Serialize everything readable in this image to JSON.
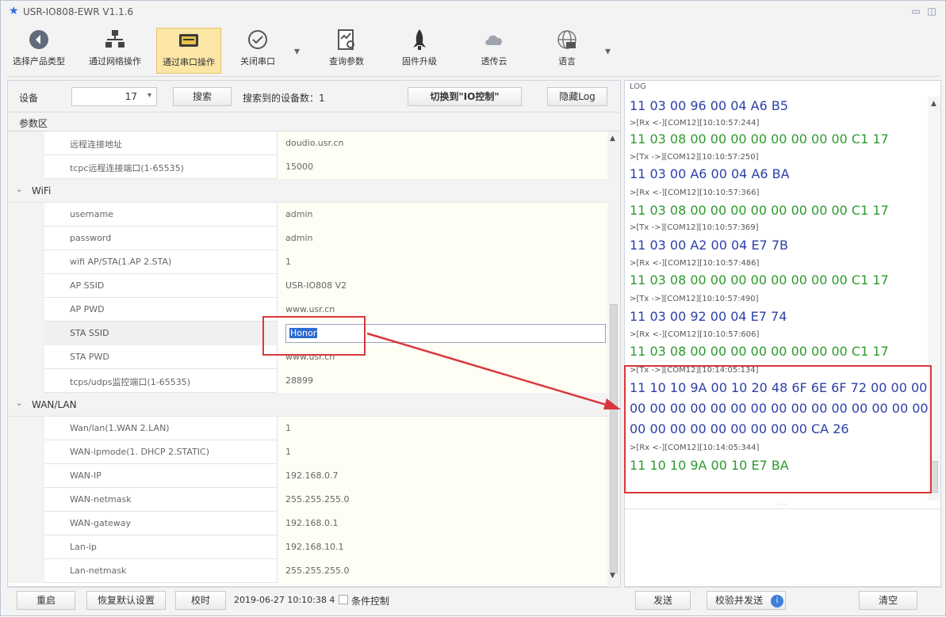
{
  "window": {
    "title": "USR-IO808-EWR V1.1.6",
    "minimize": "▭",
    "maximize": "◫"
  },
  "toolbar": {
    "items": [
      {
        "label": "选择产品类型",
        "icon": "back-arrow-icon"
      },
      {
        "label": "通过网络操作",
        "icon": "network-icon"
      },
      {
        "label": "通过串口操作",
        "icon": "serial-port-icon",
        "active": true
      },
      {
        "label": "关闭串口",
        "icon": "check-circle-icon"
      },
      {
        "label": "查询参数",
        "icon": "query-doc-icon"
      },
      {
        "label": "固件升级",
        "icon": "rocket-icon"
      },
      {
        "label": "透传云",
        "icon": "cloud-icon"
      },
      {
        "label": "语言",
        "icon": "globe-icon"
      }
    ]
  },
  "device_bar": {
    "label": "设备",
    "selected": "17",
    "search": "搜索",
    "found": "搜索到的设备数：1",
    "switch": "切换到\"IO控制\"",
    "hide_log": "隐藏Log"
  },
  "params": {
    "title": "参数区",
    "rows": [
      {
        "key": "远程连接地址",
        "value": "doudio.usr.cn"
      },
      {
        "key": "tcpc远程连接端口(1-65535)",
        "value": "15000"
      },
      {
        "section": "WiFi"
      },
      {
        "key": "username",
        "value": "admin"
      },
      {
        "key": "password",
        "value": "admin"
      },
      {
        "key": "wifi AP/STA(1.AP 2.STA)",
        "value": "1"
      },
      {
        "key": "AP SSID",
        "value": "USR-IO808 V2"
      },
      {
        "key": "AP PWD",
        "value": "www.usr.cn"
      },
      {
        "key": "STA SSID",
        "value": "Honor",
        "editing": true
      },
      {
        "key": "STA PWD",
        "value": "www.usr.cn"
      },
      {
        "key": "tcps/udps监控端口(1-65535)",
        "value": "28899"
      },
      {
        "section": "WAN/LAN"
      },
      {
        "key": "Wan/lan(1.WAN 2.LAN)",
        "value": "1"
      },
      {
        "key": "WAN-ipmode(1. DHCP 2.STATIC)",
        "value": "1"
      },
      {
        "key": "WAN-IP",
        "value": "192.168.0.7"
      },
      {
        "key": "WAN-netmask",
        "value": "255.255.255.0"
      },
      {
        "key": "WAN-gateway",
        "value": "192.168.0.1"
      },
      {
        "key": "Lan-ip",
        "value": "192.168.10.1"
      },
      {
        "key": "Lan-netmask",
        "value": "255.255.255.0"
      }
    ]
  },
  "bottom": {
    "restart": "重启",
    "restore": "恢复默认设置",
    "calibrate": "校时",
    "timestamp": "2019-06-27 10:10:38 4",
    "conditional": "条件控制"
  },
  "log": {
    "header": "LOG",
    "lines": [
      {
        "type": "hex",
        "color": "blue",
        "text": "11 03 00 96 00 04 A6 B5"
      },
      {
        "type": "meta",
        "text": ">[Rx <-][COM12][10:10:57:244]"
      },
      {
        "type": "hex",
        "color": "green",
        "text": "11 03 08 00 00 00 00 00 00 00 00 C1 17"
      },
      {
        "type": "meta",
        "text": ">[Tx ->][COM12][10:10:57:250]"
      },
      {
        "type": "hex",
        "color": "blue",
        "text": "11 03 00 A6 00 04 A6 BA"
      },
      {
        "type": "meta",
        "text": ">[Rx <-][COM12][10:10:57:366]"
      },
      {
        "type": "hex",
        "color": "green",
        "text": "11 03 08 00 00 00 00 00 00 00 00 C1 17"
      },
      {
        "type": "meta",
        "text": ">[Tx ->][COM12][10:10:57:369]"
      },
      {
        "type": "hex",
        "color": "blue",
        "text": "11 03 00 A2 00 04 E7 7B"
      },
      {
        "type": "meta",
        "text": ">[Rx <-][COM12][10:10:57:486]"
      },
      {
        "type": "hex",
        "color": "green",
        "text": "11 03 08 00 00 00 00 00 00 00 00 C1 17"
      },
      {
        "type": "meta",
        "text": ">[Tx ->][COM12][10:10:57:490]"
      },
      {
        "type": "hex",
        "color": "blue",
        "text": "11 03 00 92 00 04 E7 74"
      },
      {
        "type": "meta",
        "text": ">[Rx <-][COM12][10:10:57:606]"
      },
      {
        "type": "hex",
        "color": "green",
        "text": "11 03 08 00 00 00 00 00 00 00 00 C1 17"
      },
      {
        "type": "meta",
        "text": ">[Tx ->][COM12][10:14:05:134]"
      },
      {
        "type": "hex",
        "color": "blue",
        "text": "11 10 10 9A 00 10 20 48 6F 6E 6F 72 00 00 00"
      },
      {
        "type": "hex",
        "color": "blue",
        "text": "00 00 00 00 00 00 00 00 00 00 00 00 00 00 00"
      },
      {
        "type": "hex",
        "color": "blue",
        "text": "00 00 00 00 00 00 00 00 00 CA 26"
      },
      {
        "type": "meta",
        "text": ">[Rx <-][COM12][10:14:05:344]"
      },
      {
        "type": "hex",
        "color": "green",
        "text": "11 10 10 9A 00 10 E7 BA"
      }
    ],
    "send": "发送",
    "verify_send": "校验并发送",
    "clear": "清空",
    "splitter": "....."
  },
  "colors": {
    "hex_blue": "#2c3fa8",
    "hex_green": "#2e9a2e",
    "highlight": "#d8383b",
    "active_tool": "#fbe6a5"
  }
}
